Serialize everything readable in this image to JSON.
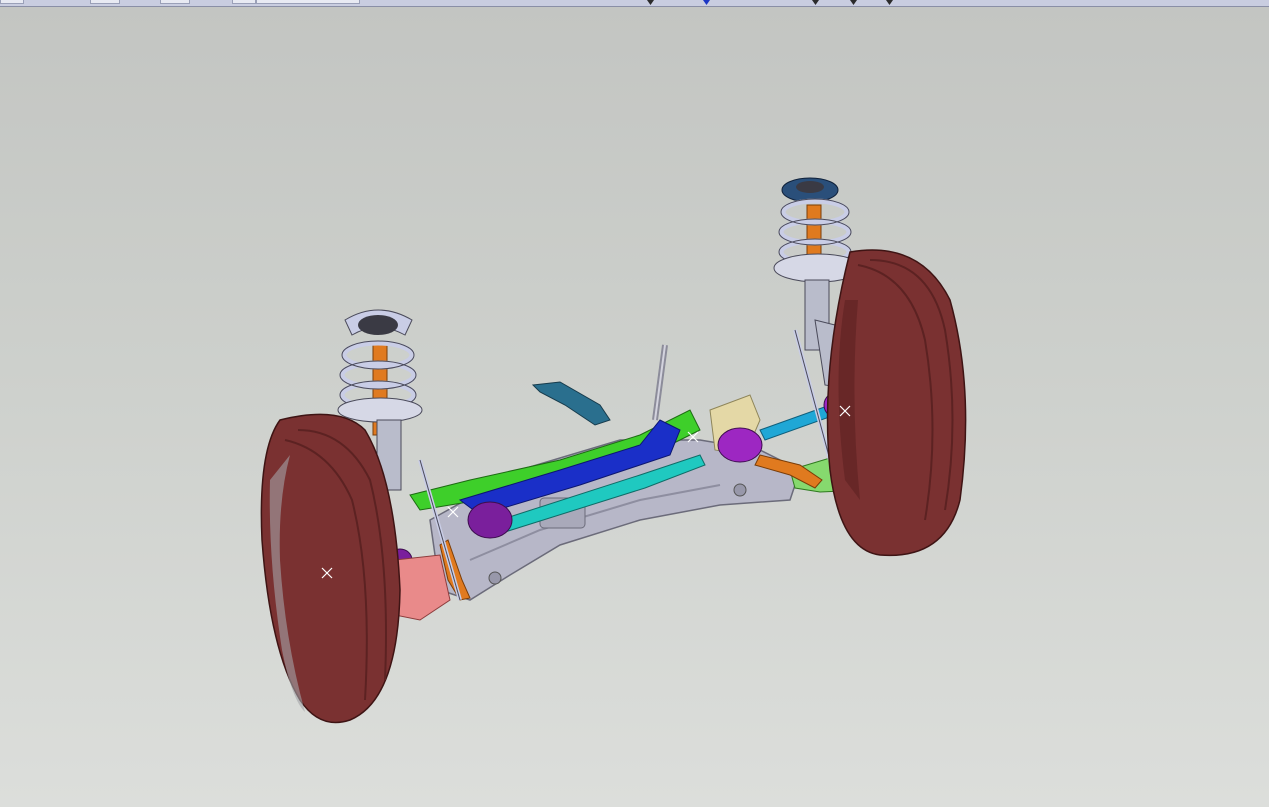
{
  "window": {
    "background_top": "#c3c5c2",
    "background_bottom": "#dcdedb"
  },
  "toolbar": {
    "accent": "#c9cde0"
  },
  "viewport": {
    "model_description_icon": "front-suspension-assembly-model",
    "colors": {
      "tire": "#7a3131",
      "tire_dark": "#5c2222",
      "spring": "#c9cde6",
      "damper": "#e07a1f",
      "subframe": "#b7b7c8",
      "steering_rack": "#1a2fc8",
      "crossmember_green": "#3ecf2a",
      "driveshaft_cyan": "#1fc9c0",
      "boot_purple": "#7a1f9c",
      "control_arm_pink": "#e98a8a",
      "bracket_teal": "#2a6f8e"
    },
    "selection_marks": [
      "x",
      "x",
      "x",
      "x"
    ]
  }
}
